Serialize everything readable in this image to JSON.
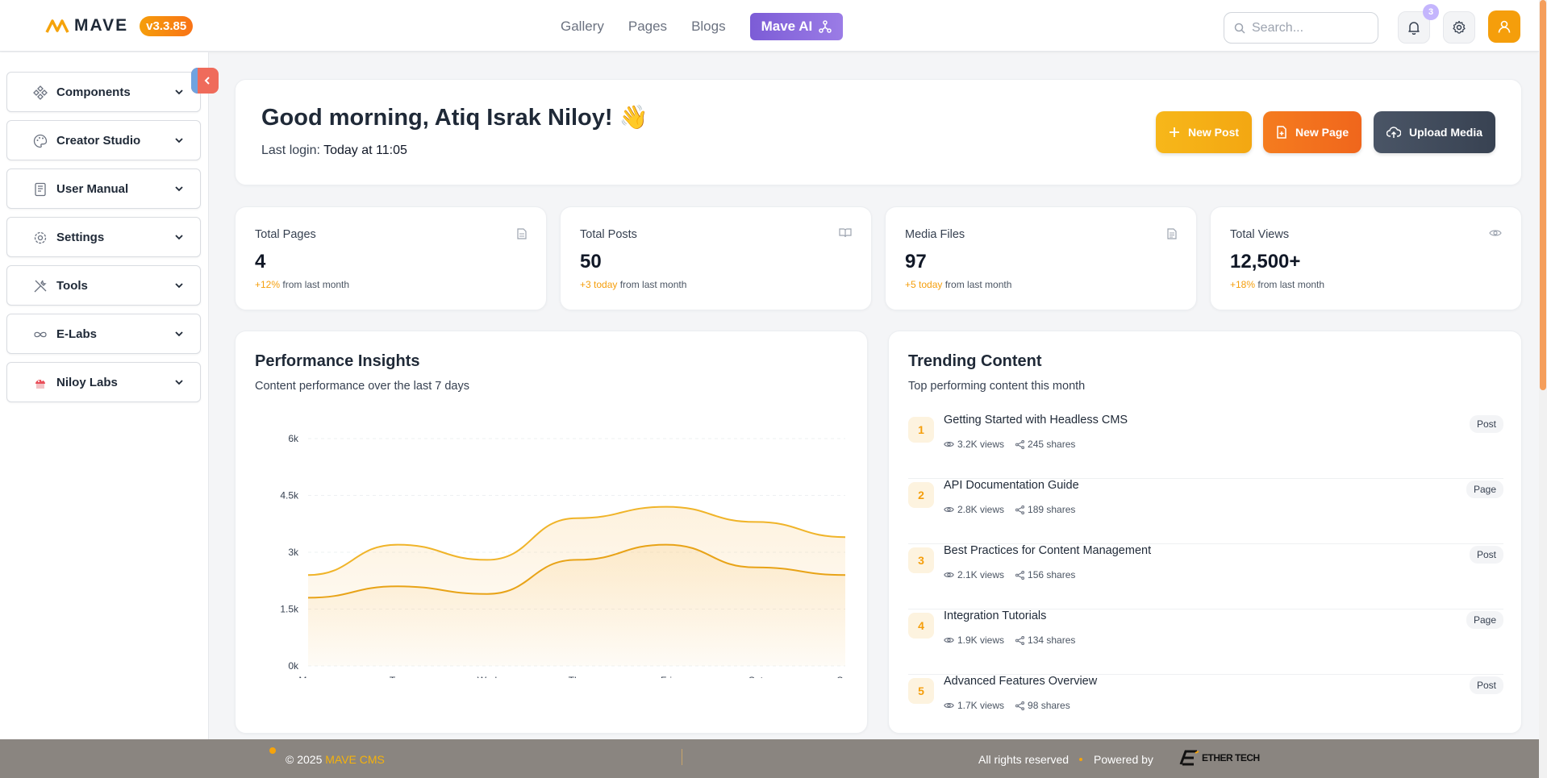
{
  "header": {
    "logo_text": "MAVE",
    "version": "v3.3.85",
    "nav": [
      "Gallery",
      "Pages",
      "Blogs"
    ],
    "ai_label": "Mave AI",
    "search_placeholder": "Search...",
    "notification_count": "3",
    "icons": {
      "search": "search-icon",
      "bell": "bell-icon",
      "settings": "gear-icon",
      "user": "user-icon"
    }
  },
  "sidebar": {
    "items": [
      {
        "label": "Components",
        "icon": "components-icon"
      },
      {
        "label": "Creator Studio",
        "icon": "palette-icon"
      },
      {
        "label": "User Manual",
        "icon": "book-icon"
      },
      {
        "label": "Settings",
        "icon": "gear-icon"
      },
      {
        "label": "Tools",
        "icon": "tools-icon"
      },
      {
        "label": "E-Labs",
        "icon": "infinity-icon"
      },
      {
        "label": "Niloy Labs",
        "icon": "lab-logo-icon"
      }
    ]
  },
  "welcome": {
    "greeting": "Good morning, Atiq Israk Niloy! 👋",
    "last_login_label": "Last login:",
    "last_login_value": "Today at 11:05",
    "actions": [
      "New Post",
      "New Page",
      "Upload Media"
    ]
  },
  "stats": [
    {
      "title": "Total Pages",
      "value": "4",
      "delta": "+12%",
      "note": "from last month",
      "icon": "file-icon"
    },
    {
      "title": "Total Posts",
      "value": "50",
      "delta": "+3 today",
      "note": "from last month",
      "icon": "book-open-icon"
    },
    {
      "title": "Media Files",
      "value": "97",
      "delta": "+5 today",
      "note": "from last month",
      "icon": "file-text-icon"
    },
    {
      "title": "Total Views",
      "value": "12,500+",
      "delta": "+18%",
      "note": "from last month",
      "icon": "eye-icon"
    }
  ],
  "performance": {
    "title": "Performance Insights",
    "subtitle": "Content performance over the last 7 days"
  },
  "chart_data": {
    "type": "area",
    "categories": [
      "Mon",
      "Tue",
      "Wed",
      "Thu",
      "Fri",
      "Sat",
      "Sun"
    ],
    "y_ticks": [
      "0k",
      "1.5k",
      "3k",
      "4.5k",
      "6k"
    ],
    "ylim": [
      0,
      6000
    ],
    "grid": true,
    "series": [
      {
        "values": [
          2400,
          3200,
          2800,
          3900,
          4200,
          3800,
          3400
        ],
        "color": "#f0b429"
      },
      {
        "values": [
          1800,
          2100,
          1900,
          2800,
          3200,
          2600,
          2400
        ],
        "color": "#e8a317"
      }
    ]
  },
  "trending": {
    "title": "Trending Content",
    "subtitle": "Top performing content this month",
    "items": [
      {
        "rank": "1",
        "title": "Getting Started with Headless CMS",
        "views": "3.2K views",
        "shares": "245 shares",
        "type": "Post"
      },
      {
        "rank": "2",
        "title": "API Documentation Guide",
        "views": "2.8K views",
        "shares": "189 shares",
        "type": "Page"
      },
      {
        "rank": "3",
        "title": "Best Practices for Content Management",
        "views": "2.1K views",
        "shares": "156 shares",
        "type": "Post"
      },
      {
        "rank": "4",
        "title": "Integration Tutorials",
        "views": "1.9K views",
        "shares": "134 shares",
        "type": "Page"
      },
      {
        "rank": "5",
        "title": "Advanced Features Overview",
        "views": "1.7K views",
        "shares": "98 shares",
        "type": "Post"
      }
    ]
  },
  "footer": {
    "copyright": "© 2025",
    "brand": "MAVE CMS",
    "rights": "All rights reserved",
    "powered": "Powered by",
    "company": "ETHER TECH"
  },
  "colors": {
    "accent": "#f59e0b",
    "orange": "#f97316",
    "ai": "#7c5cd6",
    "dark_button": "#3f4a5a"
  }
}
